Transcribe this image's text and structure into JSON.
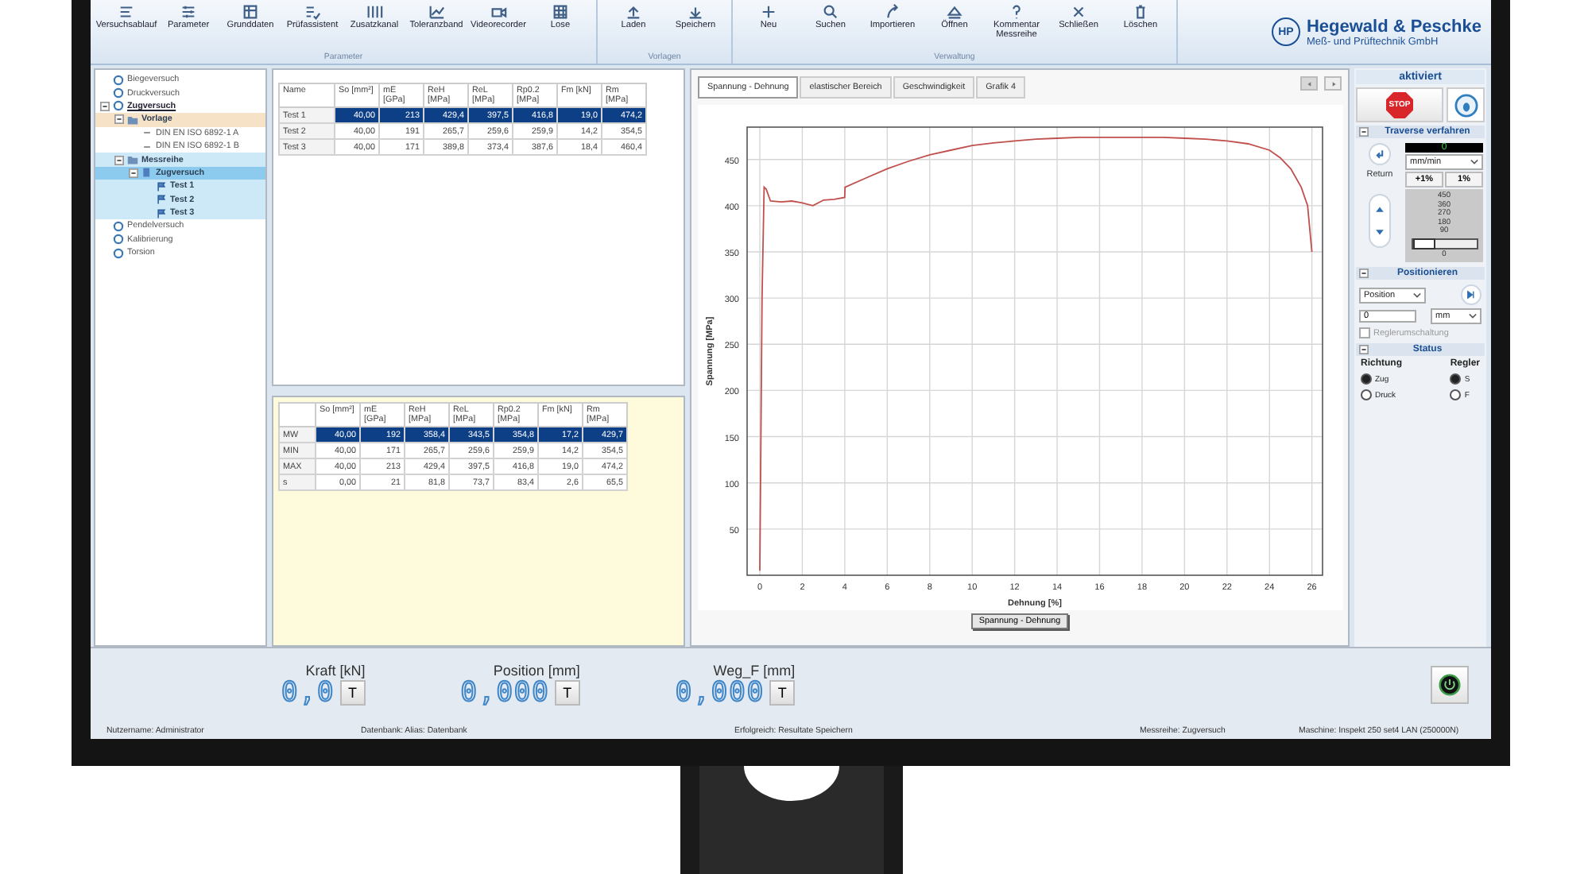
{
  "ribbon": {
    "groups": [
      {
        "label": "Parameter",
        "buttons": [
          "Versuchsablauf",
          "Parameter",
          "Grunddaten",
          "Prüfassistent",
          "Zusatzkanal",
          "Toleranzband",
          "Videorecorder",
          "Lose"
        ]
      },
      {
        "label": "Vorlagen",
        "buttons": [
          "Laden",
          "Speichern"
        ]
      },
      {
        "label": "Verwaltung",
        "buttons": [
          "Neu",
          "Suchen",
          "Importieren",
          "Öffnen",
          "Kommentar Messreihe",
          "Schließen",
          "Löschen"
        ]
      }
    ],
    "logo": {
      "mark": "HP",
      "name": "Hegewald & Peschke",
      "subtitle": "Meß- und Prüftechnik GmbH"
    }
  },
  "tree": {
    "items": [
      {
        "label": "Biegeversuch",
        "kind": "method",
        "selected": false
      },
      {
        "label": "Druckversuch",
        "kind": "method",
        "selected": false
      },
      {
        "label": "Zugversuch",
        "kind": "method",
        "selected": false,
        "active": true,
        "expanded": true,
        "children": [
          {
            "label": "Vorlage",
            "kind": "folder",
            "selected": false,
            "color": "#f6e2c6",
            "expanded": true,
            "children": [
              {
                "label": "DIN EN ISO 6892-1 A",
                "kind": "template",
                "selected": false
              },
              {
                "label": "DIN EN ISO 6892-1 B",
                "kind": "template",
                "selected": false
              }
            ]
          },
          {
            "label": "Messreihe",
            "kind": "folder",
            "selected": false,
            "color": "#cde9f7",
            "expanded": true,
            "children": [
              {
                "label": "Zugversuch",
                "kind": "series",
                "selected": true,
                "expanded": true,
                "children": [
                  {
                    "label": "Test 1",
                    "kind": "test",
                    "selected": false,
                    "color": "#cde9f7"
                  },
                  {
                    "label": "Test 2",
                    "kind": "test",
                    "selected": false,
                    "color": "#cde9f7"
                  },
                  {
                    "label": "Test 3",
                    "kind": "test",
                    "selected": false,
                    "color": "#cde9f7"
                  }
                ]
              }
            ]
          }
        ]
      },
      {
        "label": "Pendelversuch",
        "kind": "method",
        "selected": false
      },
      {
        "label": "Kalibrierung",
        "kind": "method",
        "selected": false
      },
      {
        "label": "Torsion",
        "kind": "method",
        "selected": false
      }
    ]
  },
  "results": {
    "columns": [
      "Name",
      "So [mm²]",
      "mE [GPa]",
      "ReH [MPa]",
      "ReL [MPa]",
      "Rp0.2 [MPa]",
      "Fm [kN]",
      "Rm [MPa]"
    ],
    "rows": [
      {
        "cells": [
          "Test 1",
          "40,00",
          "213",
          "429,4",
          "397,5",
          "416,8",
          "19,0",
          "474,2"
        ],
        "selected": true
      },
      {
        "cells": [
          "Test 2",
          "40,00",
          "191",
          "265,7",
          "259,6",
          "259,9",
          "14,2",
          "354,5"
        ],
        "selected": false
      },
      {
        "cells": [
          "Test 3",
          "40,00",
          "171",
          "389,8",
          "373,4",
          "387,6",
          "18,4",
          "460,4"
        ],
        "selected": false
      }
    ]
  },
  "statistics": {
    "columns": [
      "So [mm²]",
      "mE [GPa]",
      "ReH [MPa]",
      "ReL [MPa]",
      "Rp0.2 [MPa]",
      "Fm [kN]",
      "Rm [MPa]"
    ],
    "rows": [
      {
        "label": "MW",
        "cells": [
          "40,00",
          "192",
          "358,4",
          "343,5",
          "354,8",
          "17,2",
          "429,7"
        ],
        "selected": true
      },
      {
        "label": "MIN",
        "cells": [
          "40,00",
          "171",
          "265,7",
          "259,6",
          "259,9",
          "14,2",
          "354,5"
        ],
        "selected": false
      },
      {
        "label": "MAX",
        "cells": [
          "40,00",
          "213",
          "429,4",
          "397,5",
          "416,8",
          "19,0",
          "474,2"
        ],
        "selected": false
      },
      {
        "label": "s",
        "cells": [
          "0,00",
          "21",
          "81,8",
          "73,7",
          "83,4",
          "2,6",
          "65,5"
        ],
        "selected": false
      }
    ]
  },
  "chart": {
    "tabs": [
      {
        "label": "Spannung - Dehnung",
        "selected": true
      },
      {
        "label": "elastischer Bereich",
        "selected": false
      },
      {
        "label": "Geschwindigkeit",
        "selected": false
      },
      {
        "label": "Grafik 4",
        "selected": false
      }
    ],
    "chart_data": {
      "type": "line",
      "grid": true,
      "xlabel": "Dehnung [%]",
      "ylabel": "Spannung [MPa]",
      "x": [
        0,
        0.1,
        0.2,
        0.3,
        0.5,
        1,
        1.5,
        2,
        2.5,
        3,
        3.5,
        4,
        4.01,
        5,
        6,
        7,
        8,
        9,
        10,
        11,
        12,
        13,
        14,
        15,
        16,
        17,
        18,
        19,
        20,
        21,
        22,
        23,
        24,
        24.5,
        25,
        25.5,
        25.8,
        26
      ],
      "series": [
        {
          "name": "Spannung - Dehnung",
          "color": "#c0504d",
          "values": [
            5,
            300,
            420,
            418,
            405,
            404,
            405,
            403,
            400,
            406,
            407,
            409,
            420,
            430,
            440,
            448,
            455,
            460,
            465,
            468,
            470,
            472,
            473,
            474,
            474,
            474,
            474,
            474,
            473,
            472,
            470,
            467,
            460,
            452,
            440,
            420,
            400,
            350
          ]
        }
      ],
      "xlim": [
        -0.6,
        26.5
      ],
      "ylim": [
        0,
        485
      ],
      "xticks": [
        0,
        2,
        4,
        6,
        8,
        10,
        12,
        14,
        16,
        18,
        20,
        22,
        24,
        26
      ],
      "yticks": [
        50,
        100,
        150,
        200,
        250,
        300,
        350,
        400,
        450
      ]
    }
  },
  "control": {
    "status_title": "aktiviert",
    "stop_label": "STOP",
    "traverse": {
      "title": "Traverse verfahren",
      "expanded": true,
      "return_label": "Return",
      "speed": "0",
      "unit": "mm/min",
      "buttons": [
        "+1%",
        "1%"
      ],
      "scale": [
        "450",
        "360",
        "270",
        "180",
        "90"
      ],
      "slider_value": "0",
      "level": 0
    },
    "positioning": {
      "title": "Positionieren",
      "expanded": true,
      "mode": "Position",
      "value": "0",
      "unit": "mm",
      "option": {
        "label": "Reglerumschaltung",
        "checked": false,
        "disabled": true
      }
    },
    "status": {
      "title": "Status",
      "expanded": true,
      "columns": [
        "Richtung",
        "Regler"
      ],
      "direction": [
        {
          "label": "Zug",
          "selected": true
        },
        {
          "label": "Druck",
          "selected": false
        }
      ],
      "controller": [
        {
          "label": "S",
          "selected": true
        },
        {
          "label": "F",
          "selected": false
        }
      ]
    }
  },
  "readouts": [
    {
      "label": "Kraft [kN]",
      "value": "0,0",
      "button": "T"
    },
    {
      "label": "Position [mm]",
      "value": "0,000",
      "button": "T"
    },
    {
      "label": "Weg_F [mm]",
      "value": "0,000",
      "button": "T"
    }
  ],
  "status_bar": [
    "Nutzername: Administrator",
    "Datenbank: Alias: Datenbank",
    "Erfolgreich: Resultate Speichern",
    "Messreihe: Zugversuch",
    "Maschine: Inspekt 250 set4 LAN (250000N)"
  ]
}
